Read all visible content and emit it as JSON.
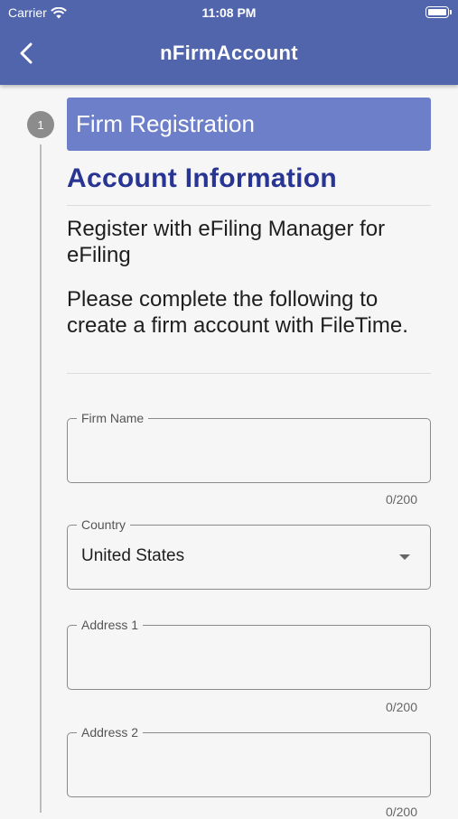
{
  "status_bar": {
    "carrier": "Carrier",
    "time": "11:08 PM"
  },
  "app_bar": {
    "title": "nFirmAccount"
  },
  "stepper": {
    "step_number": "1",
    "step_title": "Firm Registration"
  },
  "section": {
    "title": "Account Information",
    "intro": "Register with eFiling Manager for eFiling",
    "instructions": "Please complete the following to create a firm account with FileTime."
  },
  "form": {
    "firm_name": {
      "label": "Firm Name",
      "value": "",
      "counter": "0/200"
    },
    "country": {
      "label": "Country",
      "value": "United States"
    },
    "address1": {
      "label": "Address 1",
      "value": "",
      "counter": "0/200"
    },
    "address2": {
      "label": "Address 2",
      "value": "",
      "counter": "0/200"
    }
  },
  "colors": {
    "app_bar": "#5165ad",
    "step_header": "#6e7fc9",
    "section_title": "#283593"
  },
  "icons": [
    "wifi-icon",
    "battery-icon",
    "back-arrow-icon",
    "dropdown-arrow-icon"
  ]
}
